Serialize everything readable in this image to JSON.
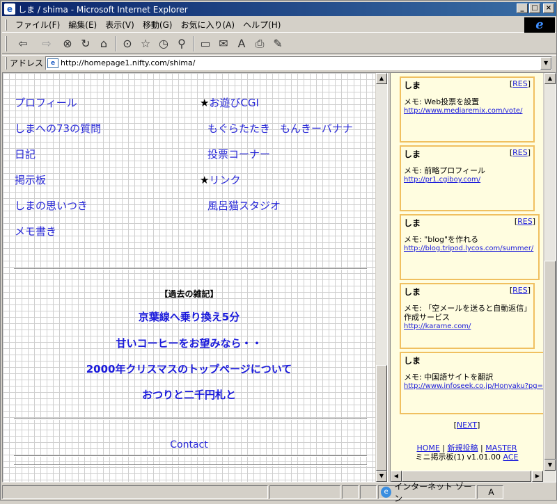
{
  "window": {
    "title": "しま / shima - Microsoft Internet Explorer",
    "controls": {
      "minimize": "_",
      "maximize": "□",
      "close": "×"
    }
  },
  "menu": [
    "ファイル(F)",
    "編集(E)",
    "表示(V)",
    "移動(G)",
    "お気に入り(A)",
    "ヘルプ(H)"
  ],
  "toolbar": {
    "back": "⇦",
    "forward": "⇨",
    "stop": "⊗",
    "refresh": "↻",
    "home": "⌂",
    "search": "⊙",
    "favorites": "☆",
    "history": "◷",
    "channels": "⚲",
    "fullscreen": "▭",
    "mail": "✉",
    "font": "A",
    "print": "⎙",
    "edit": "✎"
  },
  "address": {
    "label": "アドレス",
    "url": "http://homepage1.nifty.com/shima/"
  },
  "nav": {
    "left": [
      "プロフィール",
      "しまへの73の質問",
      "日記",
      "掲示板",
      "しまの思いつき",
      "メモ書き"
    ],
    "star1": "★",
    "star1_label": "お遊びCGI",
    "cgi1": "もぐらたたき",
    "cgi2": "もんきーバナナ",
    "cgi3": "投票コーナー",
    "star2": "★",
    "star2_label": "リンク",
    "link1": "風呂猫スタジオ"
  },
  "zakki": {
    "heading": "【過去の雑記】",
    "items": [
      "京葉線へ乗り換え5分",
      "甘いコーヒーをお望みなら・・",
      "2000年クリスマスのトップページについて",
      "おつりと二千円札と"
    ]
  },
  "contact": "Contact",
  "board": {
    "posts": [
      {
        "name": "しま",
        "res": "RES",
        "memo": "メモ: Web投票を設置",
        "url": "http://www.mediaremix.com/vote/"
      },
      {
        "name": "しま",
        "res": "RES",
        "memo": "メモ: 前略プロフィール",
        "url": "http://pr1.cgiboy.com/"
      },
      {
        "name": "しま",
        "res": "RES",
        "memo": "メモ: \"blog\"を作れる",
        "url": "http://blog.tripod.lycos.com/summer/"
      },
      {
        "name": "しま",
        "res": "RES",
        "memo": "メモ: 「空メールを送ると自動返信」作成サービス",
        "url": "http://karame.com/"
      },
      {
        "name": "しま",
        "res": "",
        "memo": "メモ: 中国語サイトを翻訳",
        "url": "http://www.infoseek.co.jp/Honyaku?pg="
      }
    ],
    "next": "NEXT",
    "footer": {
      "home": "HOME",
      "new_post": "新規投稿",
      "master": "MASTER",
      "version_text": "ミニ掲示板(1) v1.01.00",
      "ace": "ACE"
    }
  },
  "status": {
    "zone": "インターネット ゾーン",
    "ime": "A"
  }
}
